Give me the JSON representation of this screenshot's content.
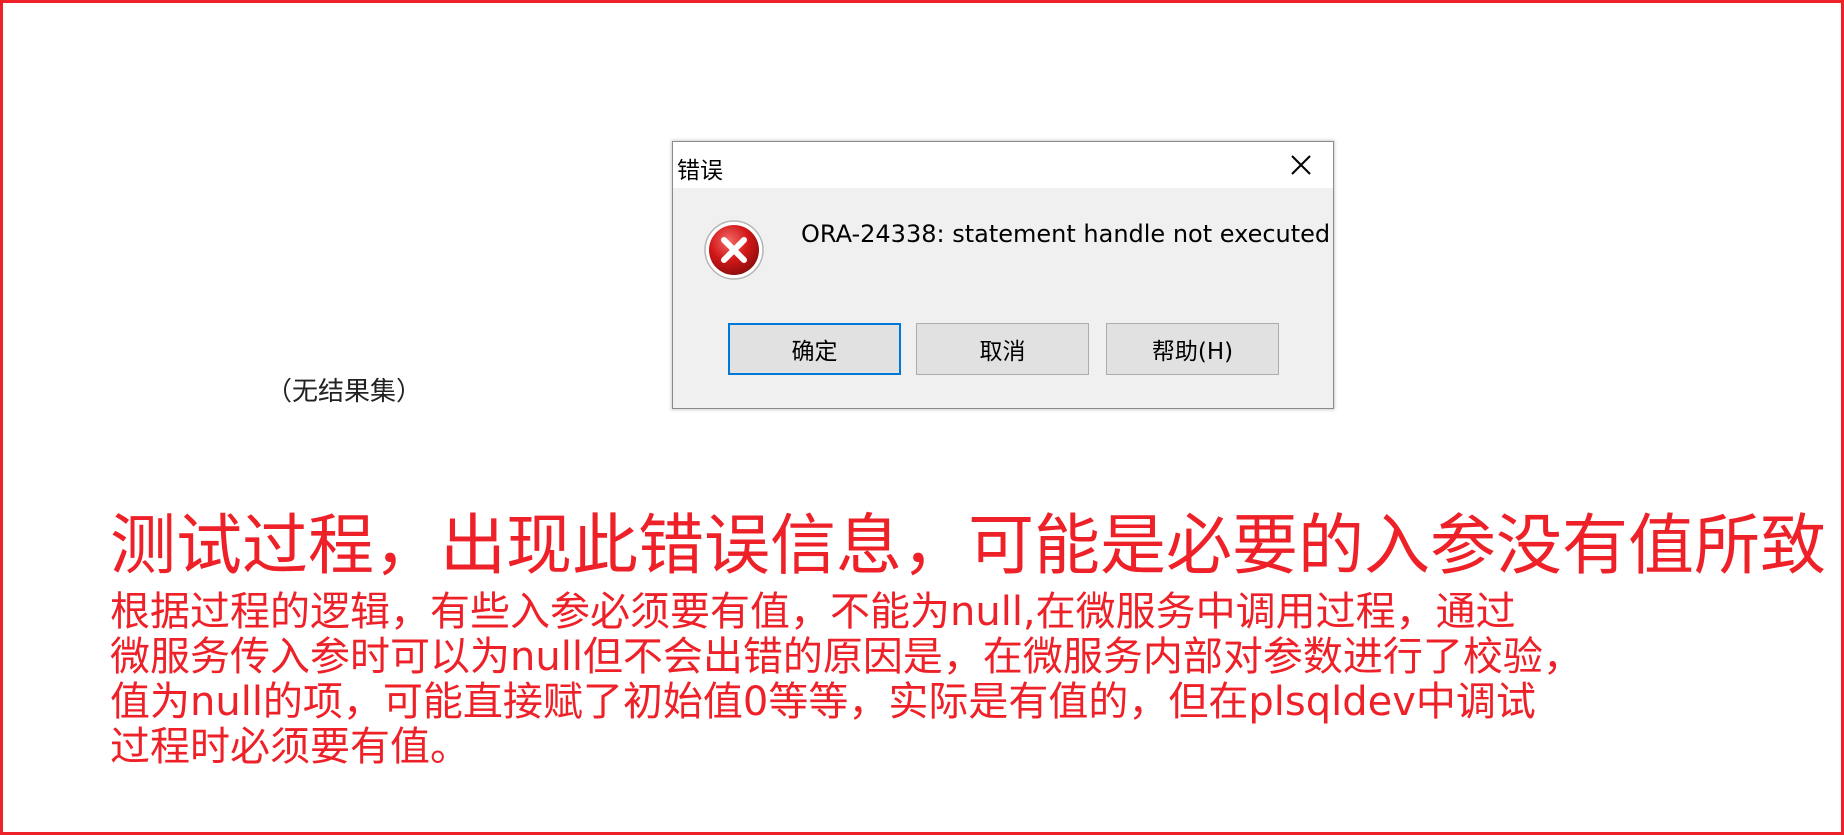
{
  "background_note": "（无结果集）",
  "dialog": {
    "title": "错误",
    "message": "ORA-24338: statement handle not executed",
    "icon": "error-icon",
    "buttons": {
      "ok": "确定",
      "cancel": "取消",
      "help": "帮助(H)"
    }
  },
  "annotation": {
    "headline": "测试过程，出现此错误信息，可能是必要的入参没有值所致",
    "lines": [
      "根据过程的逻辑，有些入参必须要有值，不能为null,在微服务中调用过程，通过",
      "微服务传入参时可以为null但不会出错的原因是，在微服务内部对参数进行了校验，",
      "值为null的项，可能直接赋了初始值0等等，实际是有值的，但在plsqldev中调试",
      "过程时必须要有值。"
    ]
  },
  "colors": {
    "accent_red": "#ee2028",
    "dialog_bg": "#f0f0f0",
    "focus_blue": "#0078d7"
  }
}
